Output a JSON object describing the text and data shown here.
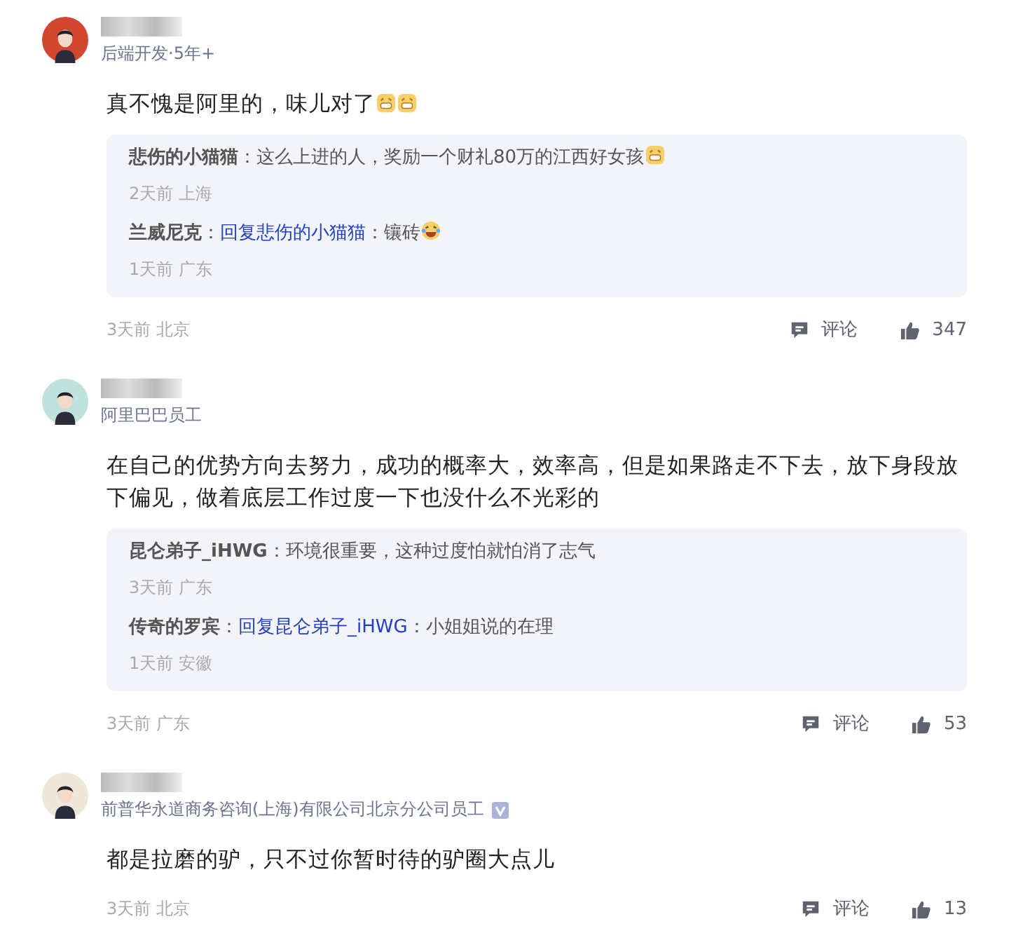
{
  "comments": [
    {
      "title": "后端开发·5年+",
      "verified": false,
      "content": "真不愧是阿里的，味儿对了",
      "emojis": [
        {
          "kind": "grin"
        },
        {
          "kind": "grin"
        }
      ],
      "replies": [
        {
          "author": "悲伤的小猫猫",
          "author_colon": "：",
          "text": "这么上进的人，奖励一个财礼80万的江西好女孩",
          "emojis": [
            {
              "kind": "grin"
            }
          ],
          "meta": "2天前 上海"
        },
        {
          "author": "兰威尼克",
          "author_colon": "：",
          "reply_to": "回复悲伤的小猫猫",
          "reply_colon": "：",
          "text": "镶砖",
          "emojis": [
            {
              "kind": "laugh"
            }
          ],
          "meta": "1天前 广东"
        }
      ],
      "meta": "3天前 北京",
      "comment_label": "评论",
      "likes": "347"
    },
    {
      "title": "阿里巴巴员工",
      "verified": false,
      "content": "在自己的优势方向去努力，成功的概率大，效率高，但是如果路走不下去，放下身段放下偏见，做着底层工作过度一下也没什么不光彩的",
      "replies": [
        {
          "author": "昆仑弟子_iHWG",
          "author_colon": "：",
          "text": "环境很重要，这种过度怕就怕消了志气",
          "meta": "3天前 广东"
        },
        {
          "author": "传奇的罗宾",
          "author_colon": "：",
          "reply_to": "回复昆仑弟子_iHWG",
          "reply_colon": "：",
          "text": "小姐姐说的在理",
          "meta": "1天前 安徽"
        }
      ],
      "meta": "3天前 广东",
      "comment_label": "评论",
      "likes": "53"
    },
    {
      "title": "前普华永道商务咨询(上海)有限公司北京分公司员工",
      "verified": true,
      "content": "都是拉磨的驴，只不过你暂时待的驴圈大点儿",
      "meta": "3天前 北京",
      "comment_label": "评论",
      "likes": "13"
    }
  ]
}
